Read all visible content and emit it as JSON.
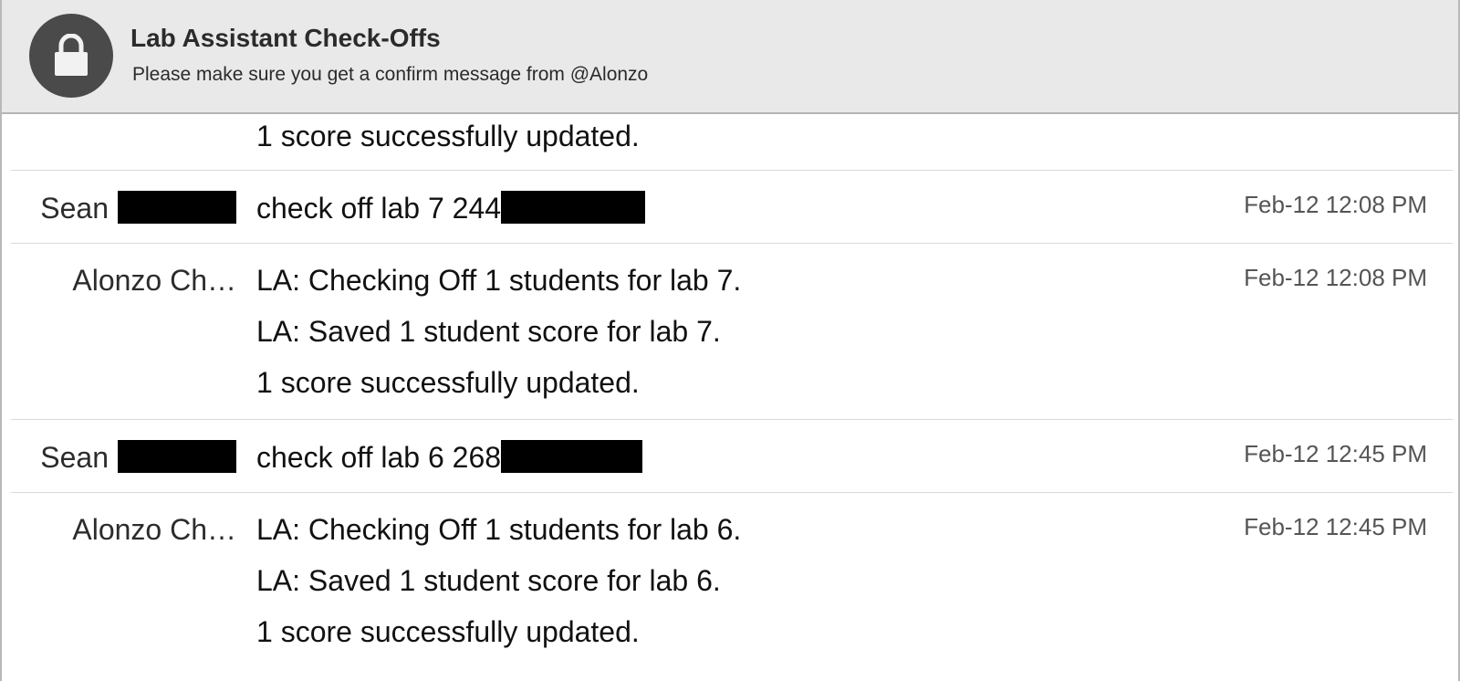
{
  "channel": {
    "icon": "lock-icon",
    "title": "Lab Assistant Check-Offs",
    "topic": "Please make sure you get a confirm message from @Alonzo"
  },
  "messages": [
    {
      "sender": "",
      "time": "",
      "lines": [
        "1 score successfully updated."
      ]
    },
    {
      "sender": "Sean",
      "time": "Feb-12 12:08 PM",
      "lines": [
        "check off lab 7 244"
      ]
    },
    {
      "sender": "Alonzo Ch…",
      "time": "Feb-12 12:08 PM",
      "lines": [
        "LA: Checking Off 1 students for lab 7.",
        "LA: Saved 1 student score for lab 7.",
        "1 score successfully updated."
      ]
    },
    {
      "sender": "Sean",
      "time": "Feb-12 12:45 PM",
      "lines": [
        "check off lab 6 268"
      ]
    },
    {
      "sender": "Alonzo Ch…",
      "time": "Feb-12 12:45 PM",
      "lines": [
        "LA: Checking Off 1 students for lab 6.",
        "LA: Saved 1 student score for lab 6.",
        "1 score successfully updated."
      ]
    }
  ]
}
